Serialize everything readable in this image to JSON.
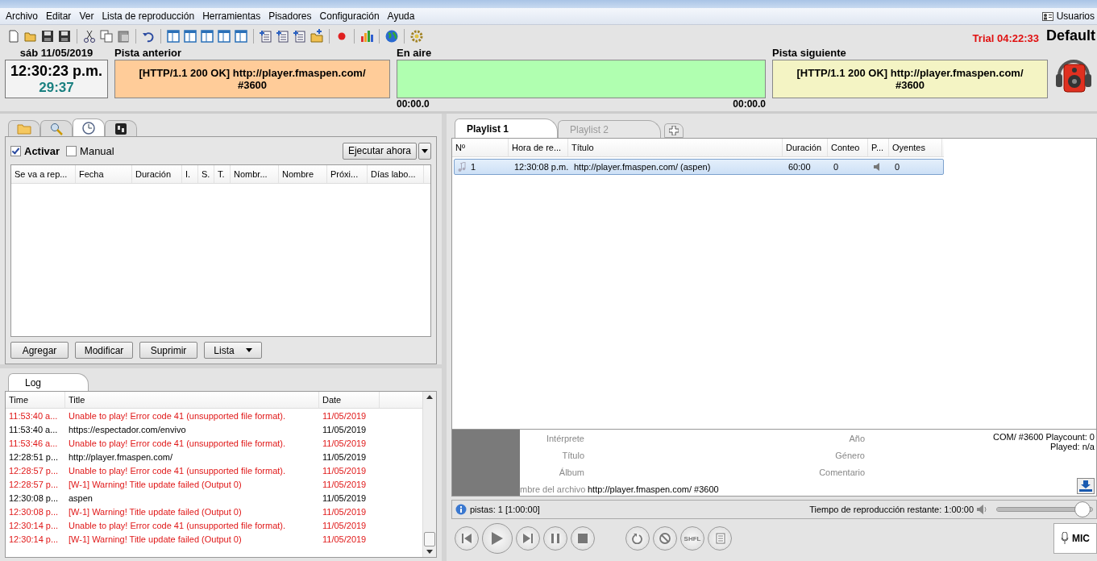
{
  "menu": [
    "Archivo",
    "Editar",
    "Ver",
    "Lista de reproducción",
    "Herramientas",
    "Pisadores",
    "Configuración",
    "Ayuda"
  ],
  "users_button": "Usuarios",
  "trial": "Trial 04:22:33",
  "profile": "Default",
  "clock": {
    "date": "sáb 11/05/2019",
    "time": "12:30:23 p.m.",
    "countdown": "29:37"
  },
  "previous_track": {
    "label": "Pista anterior",
    "text": "[HTTP/1.1 200 OK] http://player.fmaspen.com/ #3600"
  },
  "on_air": {
    "label": "En aire",
    "elapsed": "00:00.0",
    "remaining": "00:00.0"
  },
  "next_track": {
    "label": "Pista siguiente",
    "text": "[HTTP/1.1 200 OK] http://player.fmaspen.com/ #3600"
  },
  "tool_tabs": [
    {
      "kind": "folder",
      "selected": false
    },
    {
      "kind": "search",
      "selected": false
    },
    {
      "kind": "clock",
      "selected": true
    },
    {
      "kind": "panel",
      "selected": false
    }
  ],
  "scheduler": {
    "activate": {
      "label": "Activar",
      "checked": true
    },
    "manual": {
      "label": "Manual",
      "checked": false
    },
    "run_button": "Ejecutar ahora",
    "columns": [
      "Se va a rep...",
      "Fecha",
      "Duración",
      "I.",
      "S.",
      "T.",
      "Nombr...",
      "Nombre",
      "Próxi...",
      "Días labo..."
    ],
    "buttons": [
      "Agregar",
      "Modificar",
      "Suprimir",
      "Lista"
    ]
  },
  "log": {
    "tab": "Log",
    "columns": [
      "Time",
      "Title",
      "Date"
    ],
    "rows": [
      {
        "kind": "error",
        "time": "11:53:40 a...",
        "title": "Unable to play! Error code 41 (unsupported file format).",
        "date": "11/05/2019"
      },
      {
        "kind": "info",
        "time": "11:53:40 a...",
        "title": "https://espectador.com/envivo",
        "date": "11/05/2019"
      },
      {
        "kind": "error",
        "time": "11:53:46 a...",
        "title": "Unable to play! Error code 41 (unsupported file format).",
        "date": "11/05/2019"
      },
      {
        "kind": "info",
        "time": "12:28:51 p...",
        "title": "http://player.fmaspen.com/",
        "date": "11/05/2019"
      },
      {
        "kind": "error",
        "time": "12:28:57 p...",
        "title": "Unable to play! Error code 41 (unsupported file format).",
        "date": "11/05/2019"
      },
      {
        "kind": "error",
        "time": "12:28:57 p...",
        "title": "[W-1] Warning! Title update failed (Output 0)",
        "date": "11/05/2019"
      },
      {
        "kind": "info",
        "time": "12:30:08 p...",
        "title": "aspen",
        "date": "11/05/2019"
      },
      {
        "kind": "error",
        "time": "12:30:08 p...",
        "title": "[W-1] Warning! Title update failed (Output 0)",
        "date": "11/05/2019"
      },
      {
        "kind": "error",
        "time": "12:30:14 p...",
        "title": "Unable to play! Error code 41 (unsupported file format).",
        "date": "11/05/2019"
      },
      {
        "kind": "error",
        "time": "12:30:14 p...",
        "title": "[W-1] Warning! Title update failed (Output 0)",
        "date": "11/05/2019"
      }
    ]
  },
  "playlist_tabs": [
    {
      "label": "Playlist 1",
      "selected": true
    },
    {
      "label": "Playlist 2",
      "selected": false
    }
  ],
  "playlist": {
    "columns": [
      "Nº",
      "Hora de re...",
      "Título",
      "Duración",
      "Conteo",
      "P...",
      "Oyentes"
    ],
    "rows": [
      {
        "selected": true,
        "number": "1",
        "time": "12:30:08 p.m.",
        "title": "http://player.fmaspen.com/ (aspen)",
        "duration": "60:00",
        "count": "0",
        "listeners": "0"
      }
    ]
  },
  "track_info": {
    "labels_left": [
      "Intérprete",
      "Título",
      "Álbum"
    ],
    "labels_right": [
      "Año",
      "Género",
      "Comentario"
    ],
    "file_label": "mbre del archivo",
    "file_value": "http://player.fmaspen.com/ #3600",
    "stats": [
      "COM/ #3600 Playcount: 0",
      "Played: n/a"
    ]
  },
  "status": {
    "tracks": "pistas: 1 [1:00:00]",
    "remaining": "Tiempo de reproducción restante: 1:00:00",
    "volume": {
      "level": 0.97
    }
  },
  "transport": {
    "shuffle": "SHFL",
    "mic": "MIC"
  }
}
